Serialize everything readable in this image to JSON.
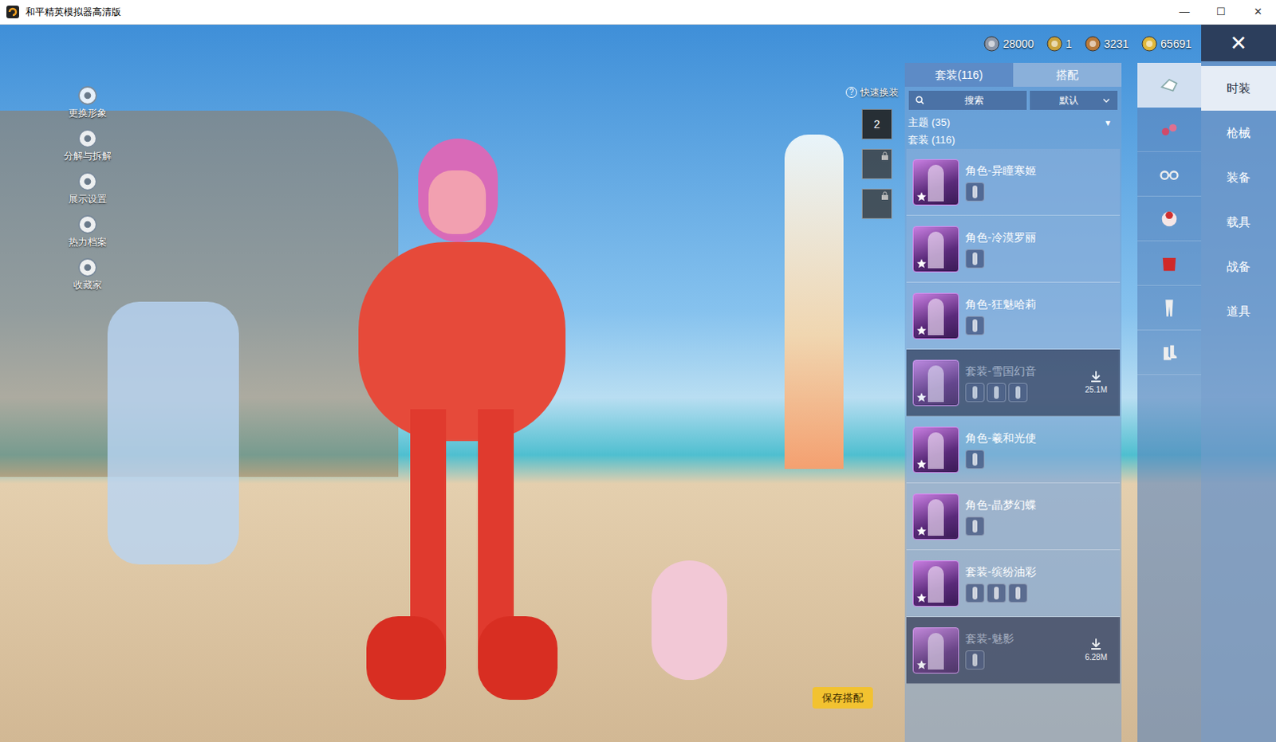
{
  "window": {
    "title": "和平精英模拟器高清版",
    "controls": [
      "—",
      "☐",
      "✕"
    ]
  },
  "currency": [
    {
      "value": "28000",
      "color": "#8a96a8"
    },
    {
      "value": "1",
      "color": "#c9a23a"
    },
    {
      "value": "3231",
      "color": "#b8793a"
    },
    {
      "value": "65691",
      "color": "#e0b83a"
    }
  ],
  "close_button": "✕",
  "stage_menu": [
    {
      "label": "更换形象"
    },
    {
      "label": "分解与拆解"
    },
    {
      "label": "展示设置"
    },
    {
      "label": "热力档案"
    },
    {
      "label": "收藏家"
    }
  ],
  "quick_change": {
    "label": "快速换装",
    "help": "?",
    "slots": [
      {
        "text": "2",
        "locked": false
      },
      {
        "text": "",
        "locked": true
      },
      {
        "text": "",
        "locked": true
      }
    ]
  },
  "save_button": "保存搭配",
  "panel": {
    "tabs": [
      {
        "label": "套装(116)",
        "selected": true
      },
      {
        "label": "搭配",
        "selected": false
      }
    ],
    "search": {
      "placeholder": "搜索"
    },
    "sort": {
      "value": "默认"
    },
    "sections": [
      {
        "label": "主题 (35)",
        "arrow": "▼"
      },
      {
        "label": "套装 (116)",
        "arrow": ""
      }
    ],
    "items": [
      {
        "name": "角色-异瞳寒姬",
        "parts": 1,
        "download": "",
        "available": true
      },
      {
        "name": "角色-冷漠罗丽",
        "parts": 1,
        "download": "",
        "available": true
      },
      {
        "name": "角色-狂魅哈莉",
        "parts": 1,
        "download": "",
        "available": true
      },
      {
        "name": "套装-雪国幻音",
        "parts": 3,
        "download": "25.1M",
        "available": false
      },
      {
        "name": "角色-羲和光使",
        "parts": 1,
        "download": "",
        "available": true
      },
      {
        "name": "角色-晶梦幻蝶",
        "parts": 1,
        "download": "",
        "available": true
      },
      {
        "name": "套装-缤纷油彩",
        "parts": 3,
        "download": "",
        "available": true
      },
      {
        "name": "套装-魅影",
        "parts": 1,
        "download": "6.28M",
        "available": false
      }
    ]
  },
  "icon_tabs": [
    {
      "selected": true
    },
    {
      "selected": false
    },
    {
      "selected": false
    },
    {
      "selected": false
    },
    {
      "selected": false
    },
    {
      "selected": false
    },
    {
      "selected": false
    }
  ],
  "categories": [
    {
      "label": "时装",
      "selected": true
    },
    {
      "label": "枪械",
      "selected": false
    },
    {
      "label": "装备",
      "selected": false
    },
    {
      "label": "载具",
      "selected": false
    },
    {
      "label": "战备",
      "selected": false
    },
    {
      "label": "道具",
      "selected": false
    }
  ]
}
